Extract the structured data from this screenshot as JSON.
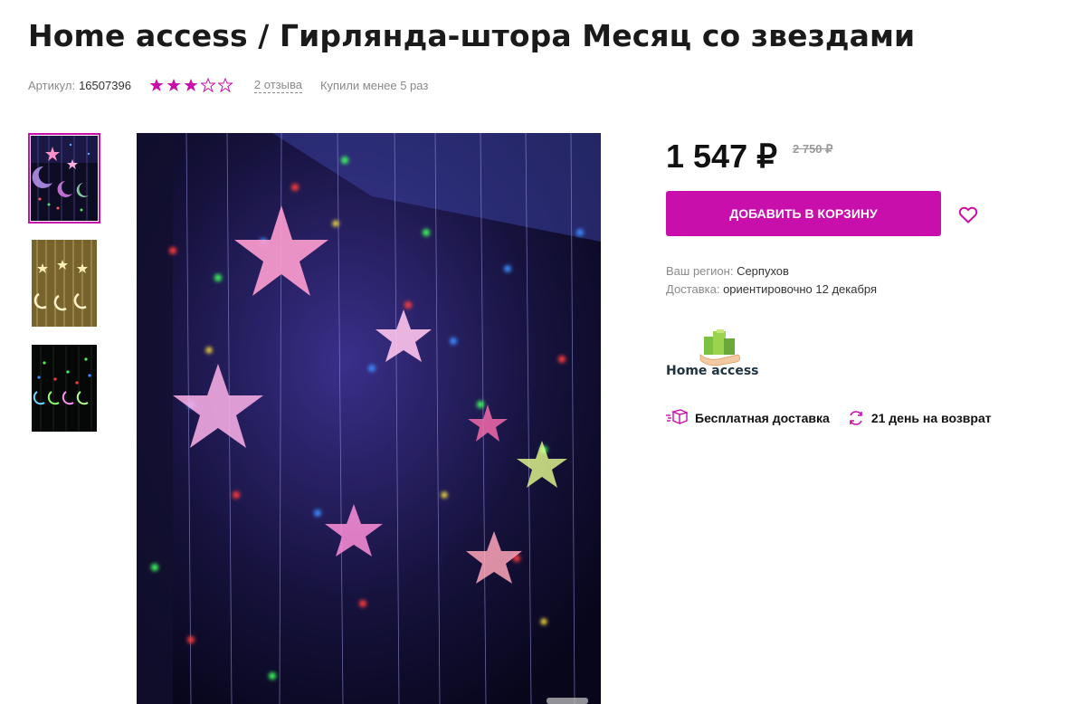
{
  "product": {
    "title": "Home access / Гирлянда-штора Месяц со звездами",
    "sku_label": "Артикул:",
    "sku_value": "16507396",
    "rating": 3,
    "rating_max": 5,
    "reviews_label": "2 отзыва",
    "bought_label": "Купили менее 5 раз"
  },
  "gallery": {
    "thumbnails": [
      "thumb-garland-colorful",
      "thumb-garland-warm-white",
      "thumb-garland-rgb"
    ],
    "active_index": 0
  },
  "purchase": {
    "price": "1 547 ₽",
    "old_price": "2 750 ₽",
    "add_to_cart_label": "ДОБАВИТЬ В КОРЗИНУ"
  },
  "delivery": {
    "region_label": "Ваш регион:",
    "region_value": "Серпухов",
    "delivery_label": "Доставка:",
    "delivery_value": "ориентировочно 12 декабря"
  },
  "brand": {
    "logo_text": "Home access"
  },
  "perks": {
    "free_delivery": "Бесплатная доставка",
    "return": "21 день на возврат"
  },
  "colors": {
    "accent": "#c80eab",
    "star_fill": "#c80eab",
    "text_muted": "#8a8a8a"
  }
}
